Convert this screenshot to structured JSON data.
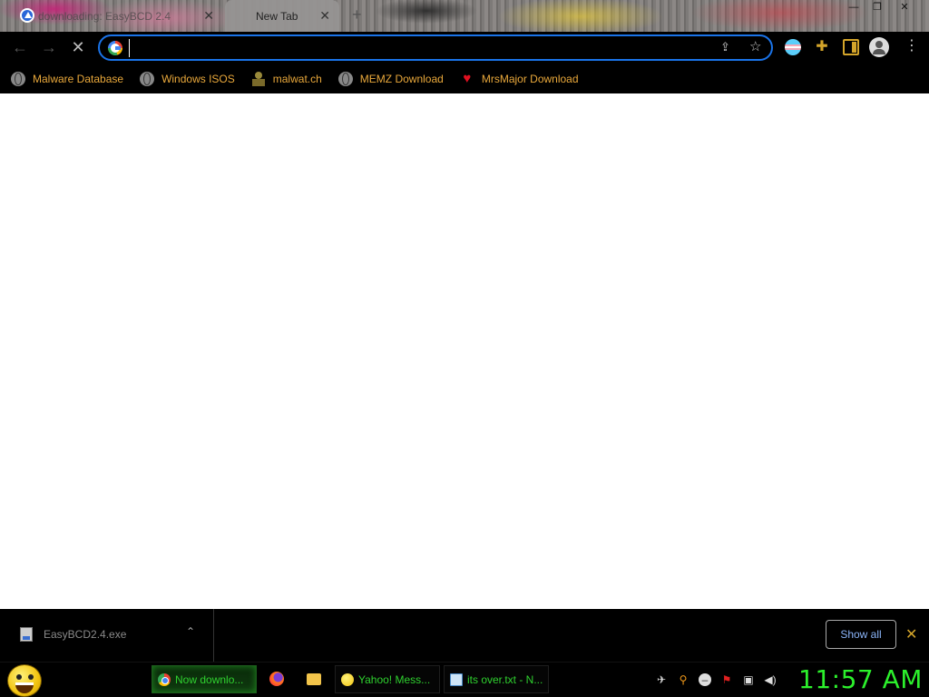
{
  "browser": {
    "tabs": [
      {
        "label": "downloading: EasyBCD 2.4",
        "close": "✕"
      },
      {
        "label": "New Tab",
        "close": "✕"
      }
    ],
    "new_tab_symbol": "+",
    "window_controls": {
      "minimize": "—",
      "maximize": "❐",
      "close": "✕"
    }
  },
  "toolbar": {
    "back_symbol": "←",
    "forward_symbol": "→",
    "stop_symbol": "✕",
    "address_value": "",
    "share_symbol": "⇪",
    "star_symbol": "☆",
    "extensions_symbol": "✚",
    "menu_symbol": "⋮"
  },
  "bookmarks": [
    {
      "label": "Malware Database",
      "icon": "globe-icon"
    },
    {
      "label": "Windows ISOS",
      "icon": "globe-icon"
    },
    {
      "label": "malwat.ch",
      "icon": "malwat-icon"
    },
    {
      "label": "MEMZ Download",
      "icon": "globe-icon"
    },
    {
      "label": "MrsMajor Download",
      "icon": "heart-icon"
    }
  ],
  "download_shelf": {
    "file_name": "EasyBCD2.4.exe",
    "chevron": "⌃",
    "show_all_label": "Show all",
    "close_symbol": "✕"
  },
  "taskbar": {
    "tasks": [
      {
        "label": "Now downlo...",
        "icon": "chrome-icon",
        "active": true
      },
      {
        "label": "Yahoo! Mess...",
        "icon": "yahoo-icon",
        "active": false
      },
      {
        "label": "its over.txt - N...",
        "icon": "notepad-icon",
        "active": false
      }
    ],
    "clock": "11:57 AM"
  },
  "colors": {
    "accent": "#1a73e8",
    "bookmark_text": "#e9a83b",
    "taskbar_text": "#2fd12f",
    "clock": "#2cf02c"
  }
}
